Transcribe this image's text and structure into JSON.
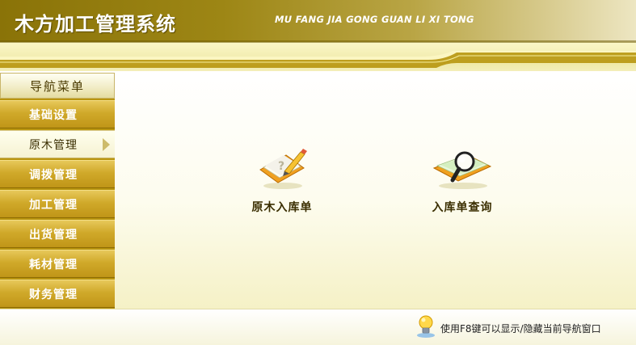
{
  "header": {
    "title": "木方加工管理系统",
    "subtitle": "MU FANG JIA GONG GUAN LI XI TONG"
  },
  "sidebar": {
    "header": "导航菜单",
    "items": [
      {
        "label": "基础设置"
      },
      {
        "label": "原木管理",
        "active": true
      },
      {
        "label": "调拨管理"
      },
      {
        "label": "加工管理"
      },
      {
        "label": "出货管理"
      },
      {
        "label": "耗材管理"
      },
      {
        "label": "财务管理"
      }
    ]
  },
  "main": {
    "functions": [
      {
        "label": "原木入库单",
        "icon": "pencil-document-icon"
      },
      {
        "label": "入库单查询",
        "icon": "magnifier-document-icon"
      }
    ]
  },
  "footer": {
    "hint": "使用F8键可以显示/隐藏当前导航窗口",
    "icon": "lightbulb-icon"
  },
  "colors": {
    "accent_gold": "#b9950f",
    "header_olive": "#8a7308"
  }
}
